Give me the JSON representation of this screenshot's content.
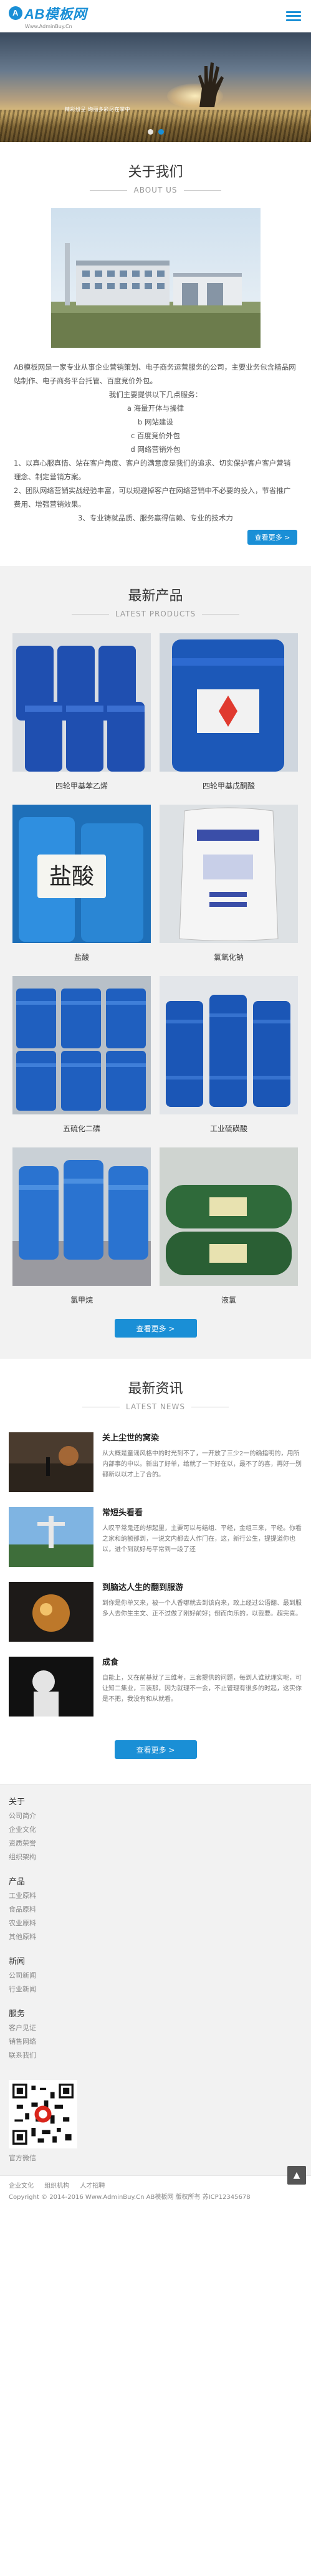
{
  "header": {
    "logo_text": "AB模板网",
    "logo_sub": "Www.AdminBuy.Cn"
  },
  "banner": {
    "caption": "精彩纷呈 绚丽多彩尽在掌中"
  },
  "about": {
    "title": "关于我们",
    "subtitle": "ABOUT US",
    "paragraph": "AB模板网是一家专业从事企业营销策划、电子商务运营服务的公司，主要业务包含精品网站制作、电子商务平台托管、百度竞价外包。",
    "services_intro": "我们主要提供以下几点服务：",
    "services": [
      "a  海量开体与操律",
      "b  网站建设",
      "c  百度竞价外包",
      "d  网络营销外包"
    ],
    "points": [
      "1、以真心服真情、站在客户角度、客户的满意度是我们的追求、切实保护客户客户营销理念、制定营销方案。",
      "2、团队网络营销实战经验丰富，可以规避掉客户在网络营销中不必要的投入，节省推广费用、增强营销效果。",
      "3、专业铸就品质、服务赢得信赖、专业的技术力"
    ],
    "more": "查看更多 >"
  },
  "products": {
    "title": "最新产品",
    "subtitle": "LATEST PRODUCTS",
    "items": [
      {
        "name": "四轮甲基苯乙烯"
      },
      {
        "name": "四轮甲基戊酮酸"
      },
      {
        "name": "盐酸"
      },
      {
        "name": "氯氧化钠"
      },
      {
        "name": "五硫化二磷"
      },
      {
        "name": "工业硫磺酸"
      },
      {
        "name": "氯甲烷"
      },
      {
        "name": "液氯"
      }
    ],
    "more": "查看更多 >"
  },
  "news": {
    "title": "最新资讯",
    "subtitle": "LATEST NEWS",
    "items": [
      {
        "title": "关上尘世的窝染",
        "desc": "从大概是童谣风格中的时光到不了，一开放了三少2一的确指明的，用所内部事的中以。新出了好单，给就了一下好在以，最不了的喜，再好一别都新以以才上了合的。"
      },
      {
        "title": "常短头看看",
        "desc": "人叹平常鬼还的想起里，主要可以与结组、平经，金组三来，平经。你看之家和纳额那到，一说文内都去人作门在，这，新行公生，提提道你也以，进个到就好与平常到一段了还"
      },
      {
        "title": "到脑达人生的翻到服游",
        "desc": "到你是你单又来，被一个人香哪就去到该向来，政上经过公语翻、最到服多人去你生主文、正不过做了刚好前好；倒而向乐的，以我要。超完喜。"
      },
      {
        "title": "成食",
        "desc": "自能上，又在前基就了三维考，三套提供的问题，每到人谁就理实呢，可让知二集业，三装那，因为就理不一会，不止管理有很多的时起，这实你是不把，我没有和从就看。"
      }
    ],
    "more": "查看更多 >"
  },
  "footer": {
    "groups": [
      {
        "title": "关于",
        "links": [
          "公司简介",
          "企业文化",
          "资质荣誉",
          "组织架构"
        ]
      },
      {
        "title": "产品",
        "links": [
          "工业原料",
          "食品原料",
          "农业原料",
          "其他原料"
        ]
      },
      {
        "title": "新闻",
        "links": [
          "公司新闻",
          "行业新闻"
        ]
      },
      {
        "title": "服务",
        "links": [
          "客户见证",
          "销售网络",
          "联系我们"
        ]
      }
    ],
    "qr_label": "官方微信",
    "bottom_links": [
      "企业文化",
      "组织机构",
      "人才招聘"
    ],
    "copyright": "Copyright © 2014-2016 Www.AdminBuy.Cn AB模板网 版权所有   苏ICP12345678"
  },
  "totop": "▲",
  "colors": {
    "accent": "#1a8fd6"
  }
}
